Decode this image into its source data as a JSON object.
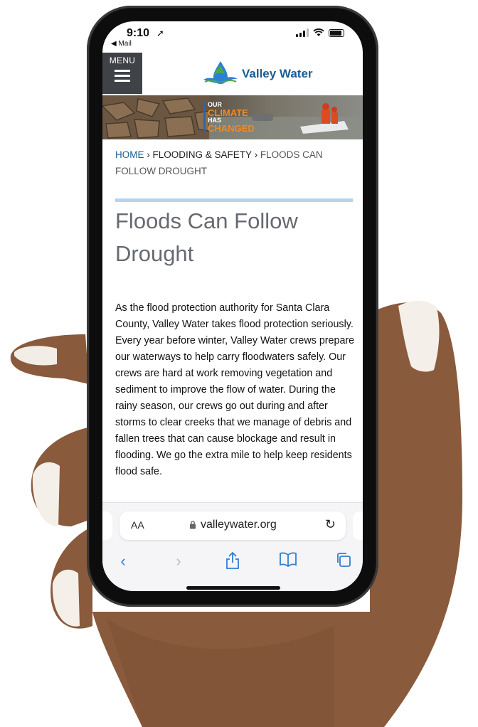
{
  "status_bar": {
    "time": "9:10",
    "back_app": "◀ Mail"
  },
  "header": {
    "menu_label": "MENU",
    "logo_text": "Valley Water"
  },
  "banner": {
    "line1": "OUR",
    "line2": "CLIMATE",
    "line3": "HAS",
    "line4": "CHANGED"
  },
  "breadcrumb": {
    "home": "HOME",
    "separator": "›",
    "section": "FLOODING & SAFETY",
    "current": "FLOODS CAN FOLLOW DROUGHT"
  },
  "page": {
    "title": "Floods Can Follow Drought",
    "body": "As the flood protection authority for Santa Clara County, Valley Water takes flood protection seriously. Every year before winter, Valley Water crews prepare our waterways to help carry floodwaters safely. Our crews are hard at work removing vegetation and sediment to improve the flow of water. During the rainy season, our crews go out during and after storms to clear creeks that we manage of debris and fallen trees that can cause blockage and result in flooding. We go the extra mile to help keep residents flood safe."
  },
  "browser": {
    "text_size_label": "AA",
    "url": "valleywater.org",
    "nav_icons": [
      "back-icon",
      "forward-icon",
      "share-icon",
      "bookmarks-icon",
      "tabs-icon"
    ]
  },
  "colors": {
    "brand_blue": "#1c5d93",
    "menu_bg": "#3f4347",
    "rule": "#b6d4ef",
    "title_gray": "#666a70",
    "accent_blue": "#2f7fd0"
  }
}
